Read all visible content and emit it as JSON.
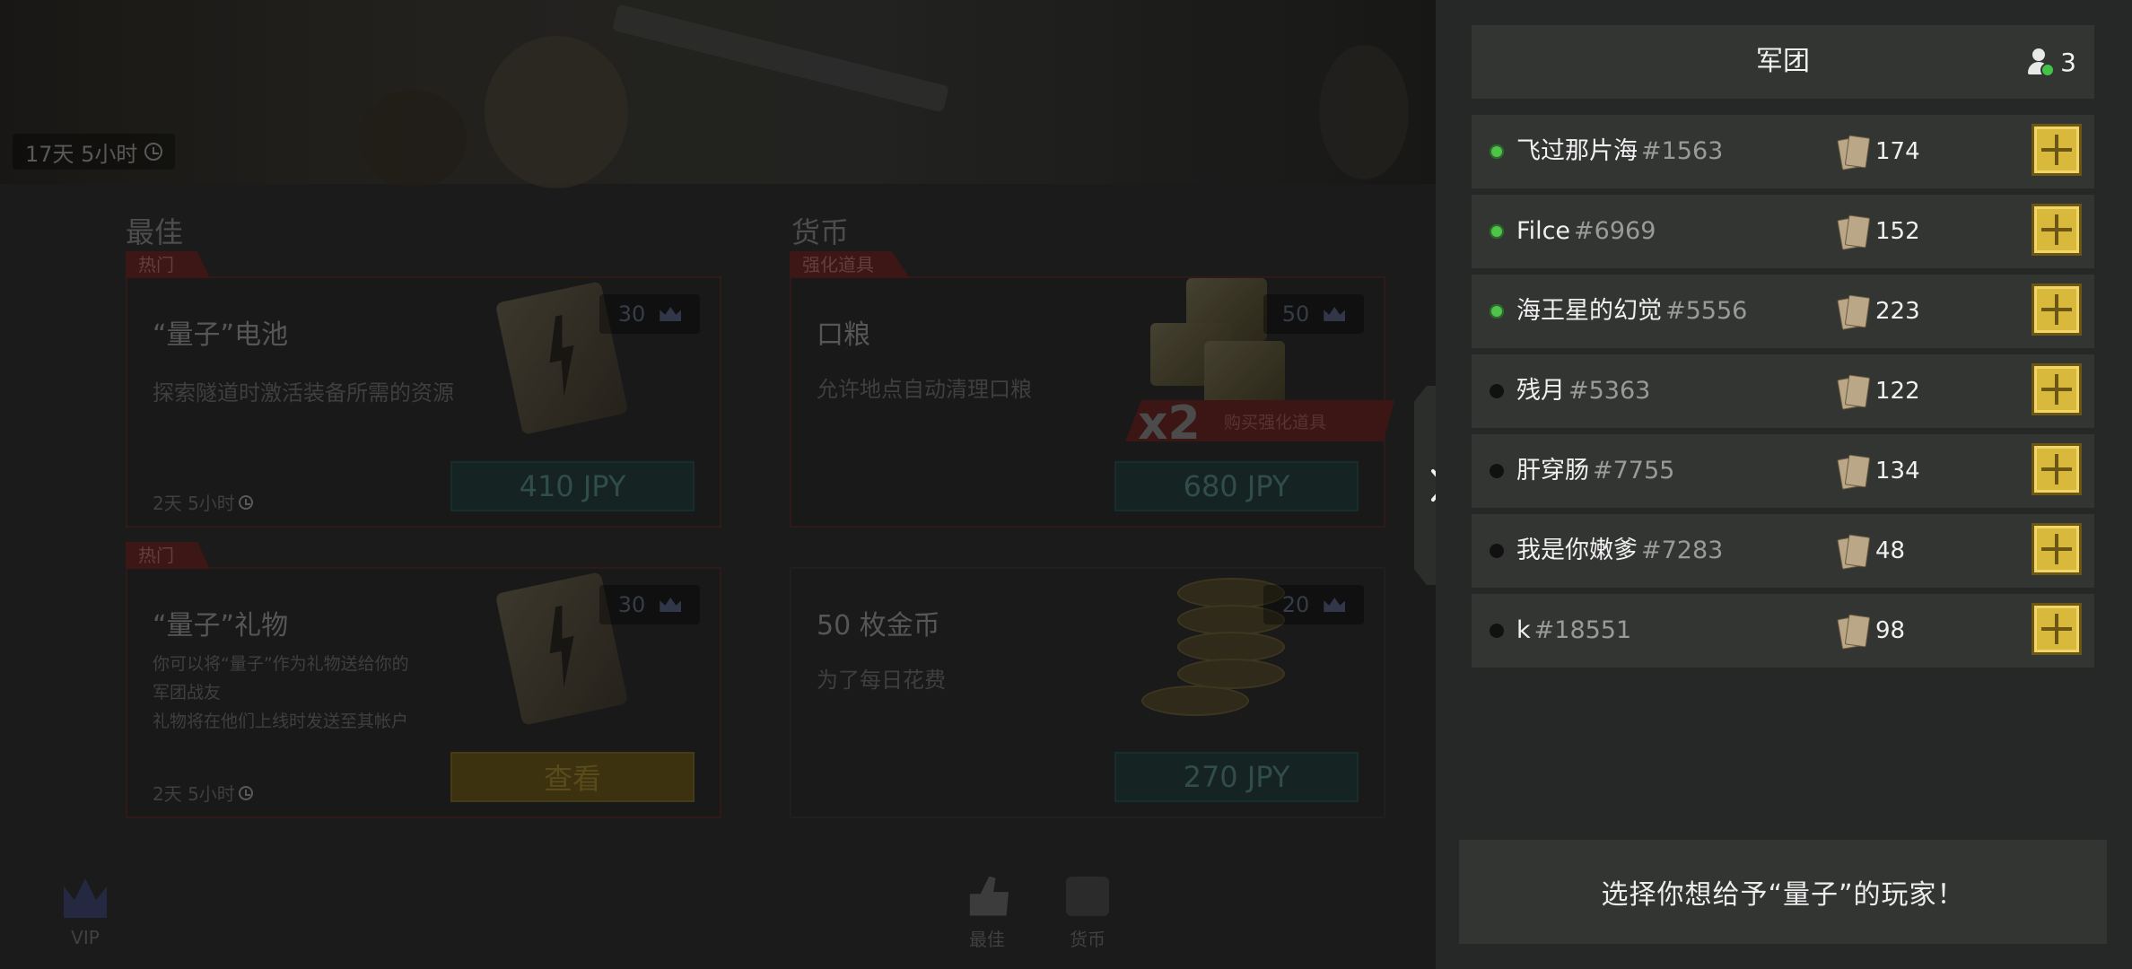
{
  "shop": {
    "banner_timer": "17天 5小时",
    "sections": {
      "best_title": "最佳",
      "currency_title": "货币"
    },
    "cards": [
      {
        "tag": "热门",
        "title": "“量子”电池",
        "desc": "探索隧道时激活装备所需的资源",
        "time": "2天 5小时",
        "badge": "30",
        "button": "410 JPY"
      },
      {
        "tag": "强化道具",
        "title": "口粮",
        "desc": "允许地点自动清理口粮",
        "badge": "50",
        "button": "680 JPY",
        "ribbon_mult": "x2",
        "ribbon_text": "购买强化道具"
      },
      {
        "tag": "热门",
        "title": "“量子”礼物",
        "desc_lines": [
          "你可以将“量子”作为礼物送给你的",
          "军团战友",
          "礼物将在他们上线时发送至其帐户"
        ],
        "time": "2天 5小时",
        "badge": "30",
        "button": "查看"
      },
      {
        "title": "50 枚金币",
        "desc": "为了每日花费",
        "badge": "20",
        "button": "270 JPY"
      }
    ],
    "nav": {
      "vip": "VIP",
      "best": "最佳",
      "currency": "货币"
    }
  },
  "panel": {
    "title": "军团",
    "member_count": "3",
    "players": [
      {
        "name": "飞过那片海",
        "tag": "#1563",
        "score": "174",
        "online": true
      },
      {
        "name": "Filce",
        "tag": "#6969",
        "score": "152",
        "online": true
      },
      {
        "name": "海王星的幻觉",
        "tag": "#5556",
        "score": "223",
        "online": true
      },
      {
        "name": "残月",
        "tag": "#5363",
        "score": "122",
        "online": false
      },
      {
        "name": "肝穿肠",
        "tag": "#7755",
        "score": "134",
        "online": false
      },
      {
        "name": "我是你嫩爹",
        "tag": "#7283",
        "score": "48",
        "online": false
      },
      {
        "name": "k",
        "tag": "#18551",
        "score": "98",
        "online": false
      }
    ],
    "hint": "选择你想给予“量子”的玩家！"
  },
  "colors": {
    "accent_gold": "#d9b93c",
    "online_green": "#4fc34a",
    "panel_bg": "#262827",
    "row_bg": "#333533"
  },
  "icons": {
    "clock": "clock-icon",
    "crown": "crown-icon",
    "add": "plus-icon",
    "member": "person-icon",
    "chevron": "chevron-right-icon",
    "score": "document-icon"
  }
}
